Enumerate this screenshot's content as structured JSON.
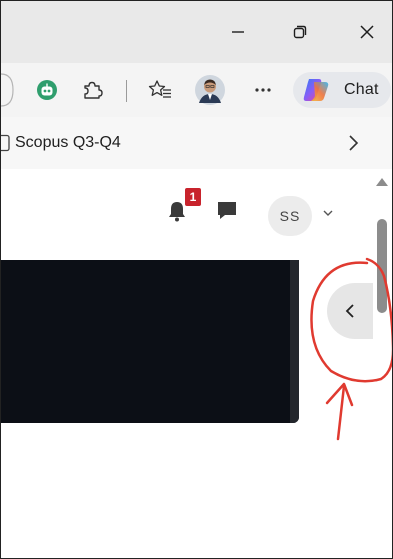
{
  "titlebar": {
    "minimize_icon": "minimize-icon",
    "restore_icon": "restore-icon",
    "close_icon": "close-icon"
  },
  "toolbar": {
    "chat_label": "Chat",
    "more_icon": "more-icon",
    "extensions_icon": "puzzle-icon",
    "favorites_icon": "favorites-star-icon",
    "extension_icon": "robot-extension-icon"
  },
  "favorites_bar": {
    "item_label": "Scopus Q3-Q4",
    "chevron_icon": "chevron-right-icon"
  },
  "page_header": {
    "notification_count": "1",
    "user_initials": "SS"
  },
  "colors": {
    "badge": "#c8232c",
    "annotation": "#e03a30",
    "dark_panel": "#0c0f16"
  }
}
